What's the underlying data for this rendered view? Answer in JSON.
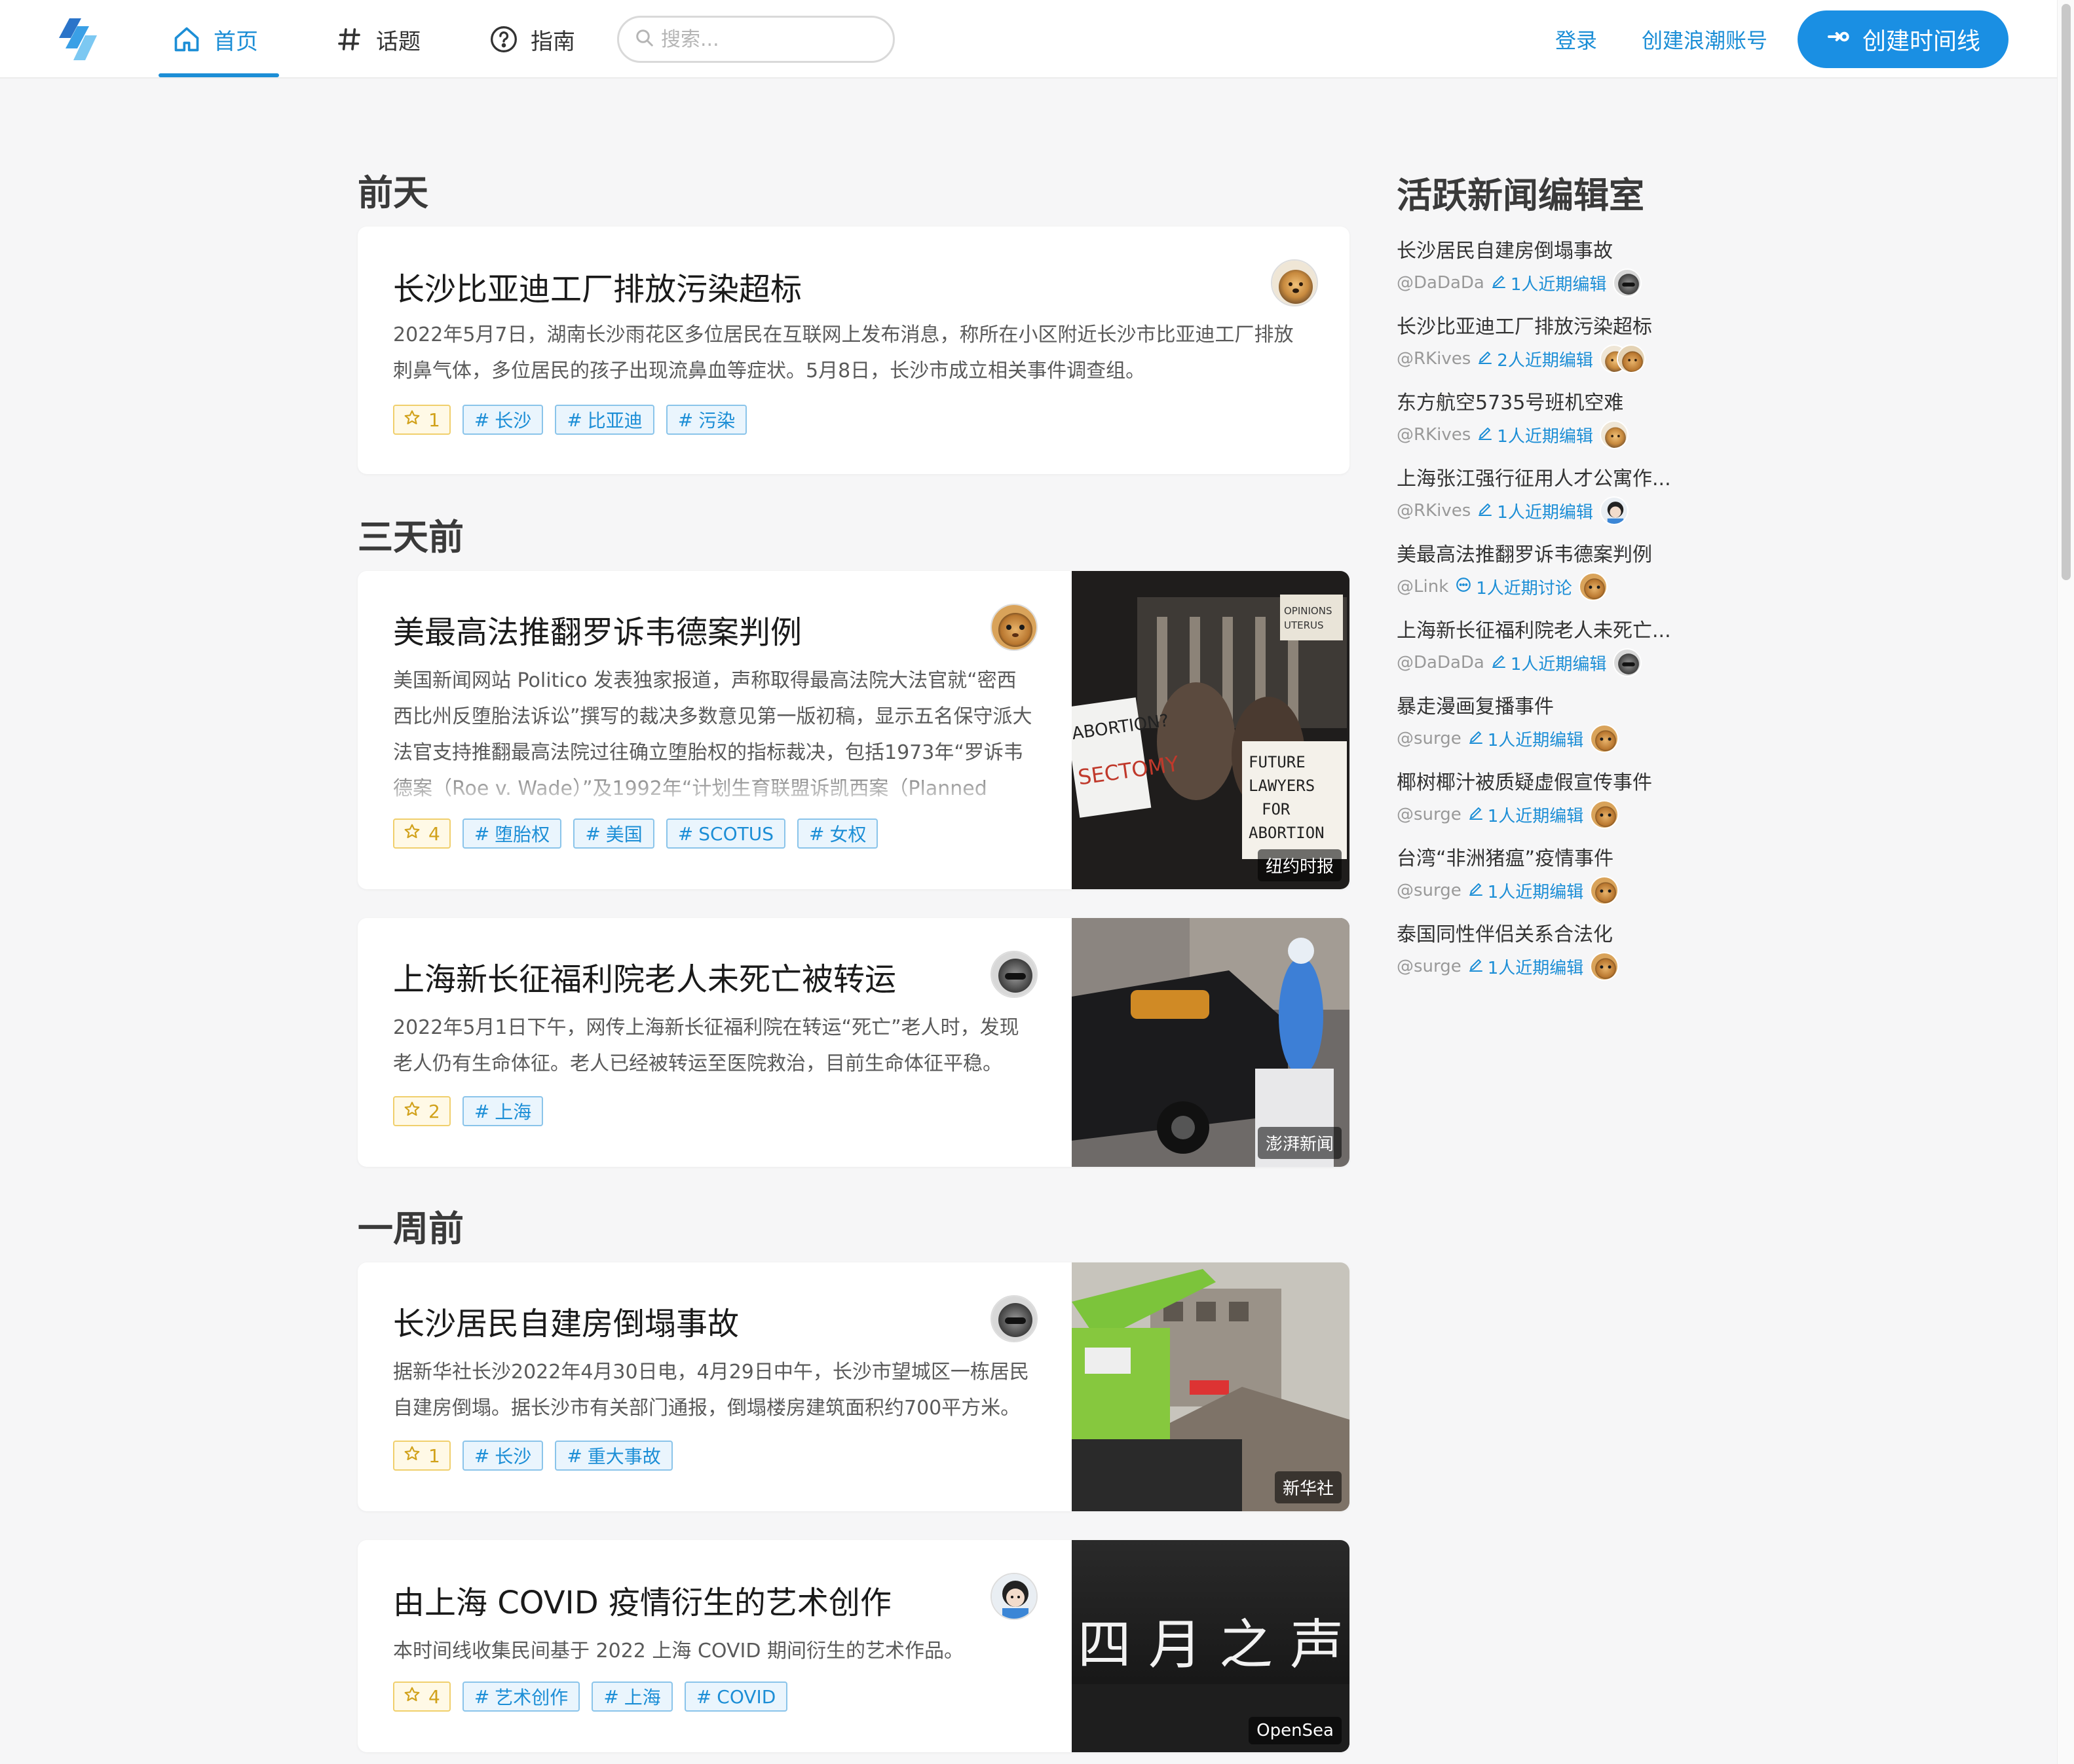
{
  "nav": {
    "home_label": "首页",
    "topics_label": "话题",
    "guide_label": "指南",
    "search_placeholder": "搜索...",
    "login_label": "登录",
    "register_label": "创建浪潮账号",
    "create_label": "创建时间线"
  },
  "sections": [
    {
      "title": "前天",
      "cards": [
        {
          "title": "长沙比亚迪工厂排放污染超标",
          "desc": "2022年5月7日，湖南长沙雨花区多位居民在互联网上发布消息，称所在小区附近长沙市比亚迪工厂排放刺鼻气体，多位居民的孩子出现流鼻血等症状。5月8日，长沙市成立相关事件调查组。",
          "stars": "1",
          "tags": [
            "长沙",
            "比亚迪",
            "污染"
          ]
        }
      ]
    },
    {
      "title": "三天前",
      "cards": [
        {
          "title": "美最高法推翻罗诉韦德案判例",
          "desc": "美国新闻网站 Politico 发表独家报道，声称取得最高法院大法官就“密西西比州反堕胎法诉讼”撰写的裁决多数意见第一版初稿，显示五名保守派大法官支持推翻最高法院过往确立堕胎权的指标裁决，包括1973年“罗诉韦德案（Roe v. Wade）”及1992年“计划生育联盟诉凯西案（Planned",
          "stars": "4",
          "tags": [
            "堕胎权",
            "美国",
            "SCOTUS",
            "女权"
          ],
          "image_source": "纽约时报",
          "sign_1": "ABORTION?",
          "sign_2": "SECTOMY",
          "sign_3": "FUTURE LAWYERS FOR ABORTION",
          "sign_4": "OPINIONS UTERUS"
        },
        {
          "title": "上海新长征福利院老人未死亡被转运",
          "desc": "2022年5月1日下午，网传上海新长征福利院在转运“死亡”老人时，发现老人仍有生命体征。老人已经被转运至医院救治，目前生命体征平稳。",
          "stars": "2",
          "tags": [
            "上海"
          ],
          "image_source": "澎湃新闻"
        }
      ]
    },
    {
      "title": "一周前",
      "cards": [
        {
          "title": "长沙居民自建房倒塌事故",
          "desc": "据新华社长沙2022年4月30日电，4月29日中午，长沙市望城区一栋居民自建房倒塌。据长沙市有关部门通报，倒塌楼房建筑面积约700平方米。",
          "stars": "1",
          "tags": [
            "长沙",
            "重大事故"
          ],
          "image_source": "新华社"
        },
        {
          "title": "由上海 COVID 疫情衍生的艺术创作",
          "desc": "本时间线收集民间基于 2022 上海 COVID 期间衍生的艺术作品。",
          "stars": "4",
          "tags": [
            "艺术创作",
            "上海",
            "COVID"
          ],
          "image_source": "OpenSea",
          "image_text": "四 月 之 声"
        }
      ]
    }
  ],
  "sidebar": {
    "title": "活跃新闻编辑室",
    "items": [
      {
        "name": "长沙居民自建房倒塌事故",
        "user": "@DaDaDa",
        "edits": "1人近期编辑"
      },
      {
        "name": "长沙比亚迪工厂排放污染超标",
        "user": "@RKives",
        "edits": "2人近期编辑"
      },
      {
        "name": "东方航空5735号班机空难",
        "user": "@RKives",
        "edits": "1人近期编辑"
      },
      {
        "name": "上海张江强行征用人才公寓作...",
        "user": "@RKives",
        "edits": "1人近期编辑"
      },
      {
        "name": "美最高法推翻罗诉韦德案判例",
        "user": "@Link",
        "edits": "1人近期讨论"
      },
      {
        "name": "上海新长征福利院老人未死亡...",
        "user": "@DaDaDa",
        "edits": "1人近期编辑"
      },
      {
        "name": "暴走漫画复播事件",
        "user": "@surge",
        "edits": "1人近期编辑"
      },
      {
        "name": "椰树椰汁被质疑虚假宣传事件",
        "user": "@surge",
        "edits": "1人近期编辑"
      },
      {
        "name": "台湾“非洲猪瘟”疫情事件",
        "user": "@surge",
        "edits": "1人近期编辑"
      },
      {
        "name": "泰国同性伴侣关系合法化",
        "user": "@surge",
        "edits": "1人近期编辑"
      }
    ]
  },
  "colors": {
    "accent": "#1c8ed6",
    "button": "#1a8fe3",
    "star": "#d1a11a",
    "background": "#f6f6f7"
  },
  "icons": [
    "home-icon",
    "hash-icon",
    "question-icon",
    "search-icon",
    "login-arrow-icon",
    "star-icon",
    "pencil-icon",
    "chat-icon"
  ]
}
